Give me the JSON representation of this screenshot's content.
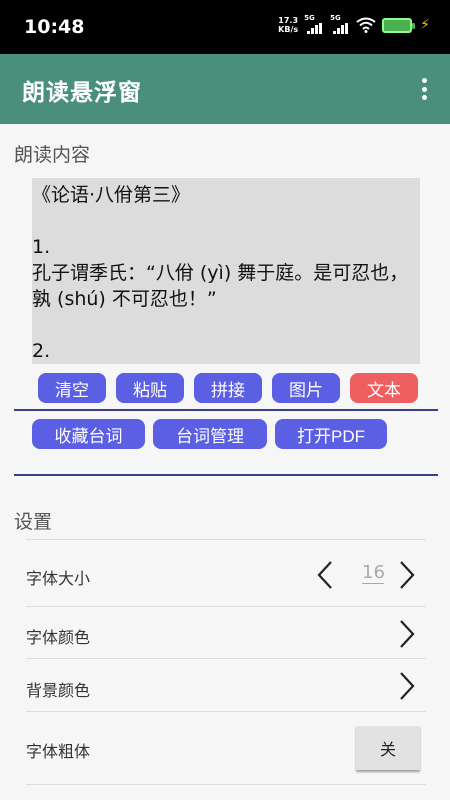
{
  "status_bar": {
    "time": "10:48",
    "net_speed_value": "17.3",
    "net_speed_unit": "KB/s",
    "signal_1": "5G",
    "signal_2": "5G"
  },
  "app_bar": {
    "title": "朗读悬浮窗"
  },
  "reading": {
    "section_label": "朗读内容",
    "content": "《论语·八佾第三》\n\n1.\n孔子谓季氏：“八佾 (yì) 舞于庭。是可忍也，孰 (shú) 不可忍也！”\n\n2."
  },
  "buttons_row1": [
    "清空",
    "粘贴",
    "拼接",
    "图片",
    "文本"
  ],
  "buttons_row2": [
    "收藏台词",
    "台词管理",
    "打开PDF"
  ],
  "settings": {
    "section_label": "设置",
    "font_size_label": "字体大小",
    "font_size_value": "16",
    "font_color_label": "字体颜色",
    "bg_color_label": "背景颜色",
    "bold_label": "字体粗体",
    "bold_value": "关"
  },
  "colors": {
    "app_bar": "#4a8f7c",
    "button": "#5b5fe3",
    "button_active": "#ef5f5f",
    "divider": "#3b3f87"
  }
}
